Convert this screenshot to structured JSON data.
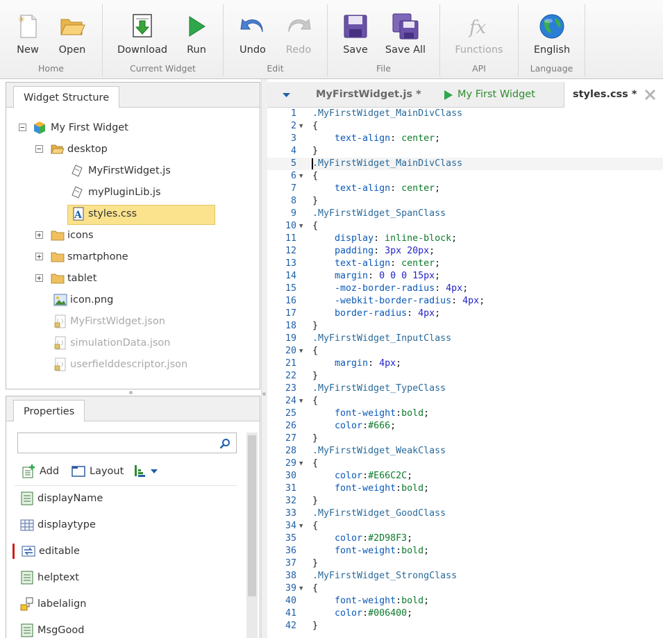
{
  "ribbon": {
    "groups": [
      {
        "title": "Home",
        "buttons": [
          {
            "label": "New",
            "icon": "new-document-icon"
          },
          {
            "label": "Open",
            "icon": "open-folder-icon"
          }
        ]
      },
      {
        "title": "Current Widget",
        "buttons": [
          {
            "label": "Download",
            "icon": "download-icon"
          },
          {
            "label": "Run",
            "icon": "run-play-icon"
          }
        ]
      },
      {
        "title": "Edit",
        "buttons": [
          {
            "label": "Undo",
            "icon": "undo-icon"
          },
          {
            "label": "Redo",
            "icon": "redo-icon"
          }
        ]
      },
      {
        "title": "File",
        "buttons": [
          {
            "label": "Save",
            "icon": "save-icon"
          },
          {
            "label": "Save All",
            "icon": "save-all-icon"
          }
        ]
      },
      {
        "title": "API",
        "buttons": [
          {
            "label": "Functions",
            "icon": "functions-fx-icon"
          }
        ]
      },
      {
        "title": "Language",
        "buttons": [
          {
            "label": "English",
            "icon": "globe-icon"
          }
        ]
      }
    ]
  },
  "widget_structure": {
    "tab": "Widget Structure",
    "items": [
      {
        "label": "My First Widget"
      },
      {
        "label": "desktop"
      },
      {
        "label": "MyFirstWidget.js"
      },
      {
        "label": "myPluginLib.js"
      },
      {
        "label": "styles.css"
      },
      {
        "label": "icons"
      },
      {
        "label": "smartphone"
      },
      {
        "label": "tablet"
      },
      {
        "label": "icon.png"
      },
      {
        "label": "MyFirstWidget.json"
      },
      {
        "label": "simulationData.json"
      },
      {
        "label": "userfielddescriptor.json"
      }
    ]
  },
  "properties": {
    "tab": "Properties",
    "search_placeholder": "",
    "toolbar": {
      "add": "Add",
      "layout": "Layout"
    },
    "items": [
      "displayName",
      "displaytype",
      "editable",
      "helptext",
      "labelalign",
      "MsgGood"
    ]
  },
  "editor": {
    "tabs": [
      "MyFirstWidget.js *",
      "My First Widget",
      "styles.css *"
    ],
    "lines": [
      ".MyFirstWidget_MainDivClass",
      "{",
      "    text-align: center;",
      "}",
      ".MyFirstWidget_MainDivClass",
      "{",
      "    text-align: center;",
      "}",
      ".MyFirstWidget_SpanClass",
      "{",
      "    display: inline-block;",
      "    padding: 3px 20px;",
      "    text-align: center;",
      "    margin: 0 0 0 15px;",
      "    -moz-border-radius: 4px;",
      "    -webkit-border-radius: 4px;",
      "    border-radius: 4px;",
      "}",
      ".MyFirstWidget_InputClass",
      "{",
      "    margin: 4px;",
      "}",
      ".MyFirstWidget_TypeClass",
      "{",
      "    font-weight:bold;",
      "    color:#666;",
      "}",
      ".MyFirstWidget_WeakClass",
      "{",
      "    color:#E66C2C;",
      "    font-weight:bold;",
      "}",
      ".MyFirstWidget_GoodClass",
      "{",
      "    color:#2D98F3;",
      "    font-weight:bold;",
      "}",
      ".MyFirstWidget_StrongClass",
      "{",
      "    font-weight:bold;",
      "    color:#006400;",
      "}"
    ]
  },
  "colors": {
    "accent_blue": "#1e5fa8",
    "run_green": "#2e8b2e",
    "selection_yellow": "#fbe38e"
  }
}
